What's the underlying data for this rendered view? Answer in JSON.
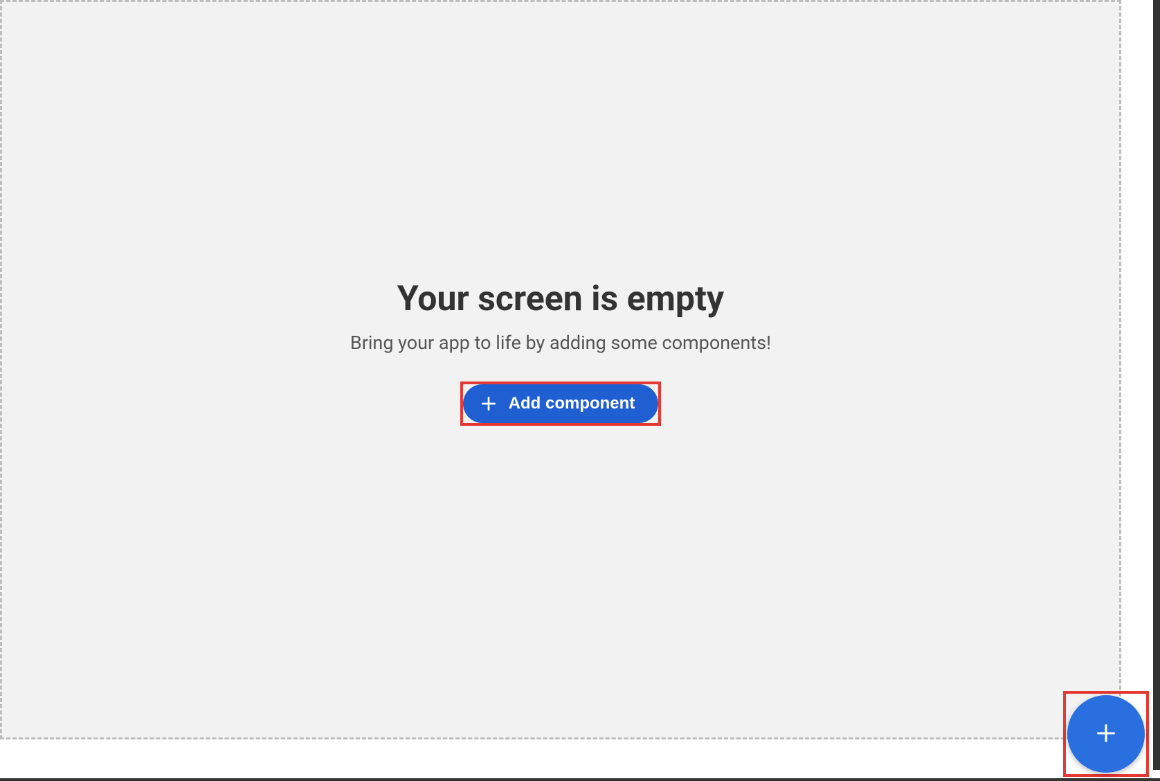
{
  "empty_state": {
    "title": "Your screen is empty",
    "subtitle": "Bring your app to life by adding some components!",
    "add_button_label": "Add component"
  },
  "colors": {
    "primary": "#1f5fd1",
    "fab": "#2a6fe0",
    "highlight": "#e53935",
    "dashed_border": "#bdbdbd",
    "canvas_bg": "#f2f2f2"
  }
}
